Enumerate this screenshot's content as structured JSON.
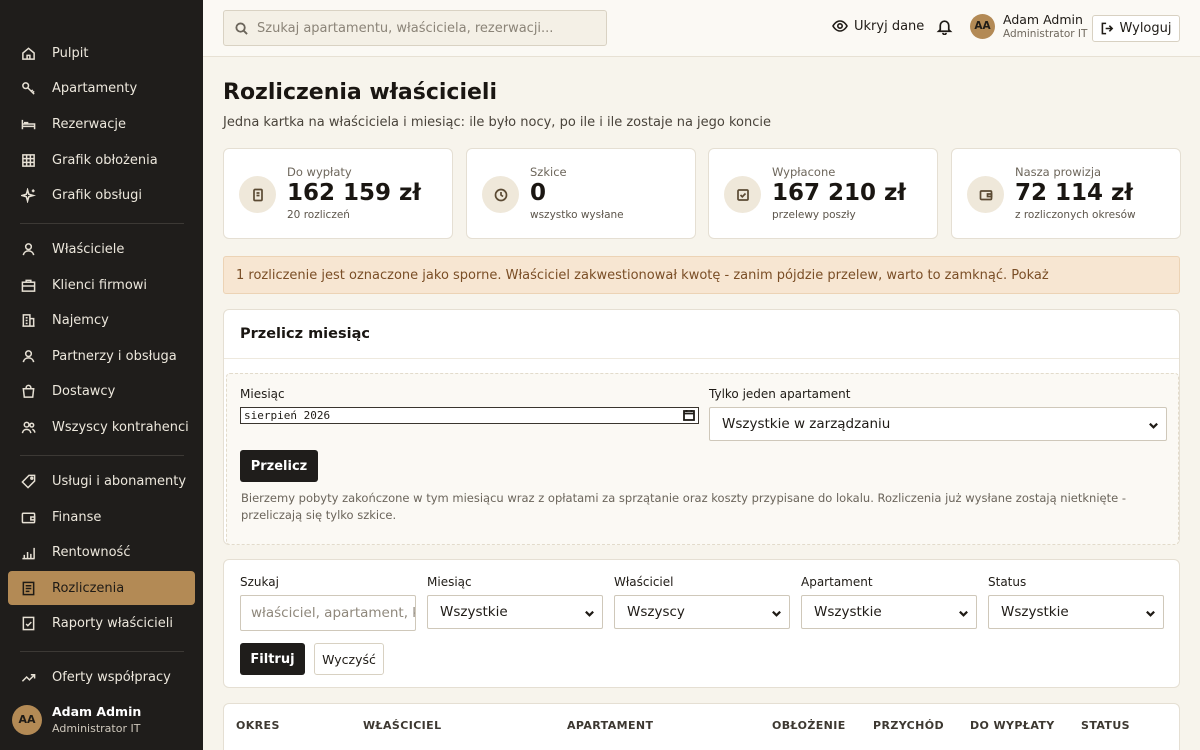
{
  "sidebar": {
    "items": [
      {
        "label": "Pulpit",
        "icon": "home-icon"
      },
      {
        "label": "Apartamenty",
        "icon": "key-icon"
      },
      {
        "label": "Rezerwacje",
        "icon": "bed-icon"
      },
      {
        "label": "Grafik obłożenia",
        "icon": "grid-icon"
      },
      {
        "label": "Grafik obsługi",
        "icon": "sparkle-icon"
      },
      {
        "label": "Właściciele",
        "icon": "user-icon"
      },
      {
        "label": "Klienci firmowi",
        "icon": "briefcase-icon"
      },
      {
        "label": "Najemcy",
        "icon": "building-icon"
      },
      {
        "label": "Partnerzy i obsługa",
        "icon": "user-icon"
      },
      {
        "label": "Dostawcy",
        "icon": "bag-icon"
      },
      {
        "label": "Wszyscy kontrahenci",
        "icon": "users-icon"
      },
      {
        "label": "Usługi i abonamenty",
        "icon": "tag-icon"
      },
      {
        "label": "Finanse",
        "icon": "wallet-icon"
      },
      {
        "label": "Rentowność",
        "icon": "bar-chart-icon"
      },
      {
        "label": "Rozliczenia",
        "icon": "receipt-icon"
      },
      {
        "label": "Raporty właścicieli",
        "icon": "check-doc-icon"
      },
      {
        "label": "Oferty współpracy",
        "icon": "trend-icon"
      }
    ],
    "active": "Rozliczenia",
    "user": {
      "initials": "AA",
      "name": "Adam Admin",
      "role": "Administrator IT"
    }
  },
  "topbar": {
    "search_placeholder": "Szukaj apartamentu, właściciela, rezerwacji...",
    "hide_data_label": "Ukryj dane",
    "user": {
      "initials": "AA",
      "name": "Adam Admin",
      "role": "Administrator IT"
    },
    "logout_label": "Wyloguj"
  },
  "page": {
    "title": "Rozliczenia właścicieli",
    "subtitle": "Jedna kartka na właściciela i miesiąc: ile było nocy, po ile i ile zostaje na jego koncie"
  },
  "stats": [
    {
      "label": "Do wypłaty",
      "value": "162 159 zł",
      "sub": "20 rozliczeń",
      "icon": "document-icon"
    },
    {
      "label": "Szkice",
      "value": "0",
      "sub": "wszystko wysłane",
      "icon": "clock-icon"
    },
    {
      "label": "Wypłacone",
      "value": "167 210 zł",
      "sub": "przelewy poszły",
      "icon": "checkbox-icon"
    },
    {
      "label": "Nasza prowizja",
      "value": "72 114 zł",
      "sub": "z rozliczonych okresów",
      "icon": "wallet-icon"
    }
  ],
  "alert": {
    "text": "1 rozliczenie jest oznaczone jako sporne. Właściciel zakwestionował kwotę - zanim pójdzie przelew, warto to zamknąć. Pokaż"
  },
  "recalc": {
    "title": "Przelicz miesiąc",
    "month_label": "Miesiąc",
    "month_value": "sierpień 2026",
    "apartment_label": "Tylko jeden apartament",
    "apartment_value": "Wszystkie w zarządzaniu",
    "button_label": "Przelicz",
    "help_text": "Bierzemy pobyty zakończone w tym miesiącu wraz z opłatami za sprzątanie oraz koszty przypisane do lokalu. Rozliczenia już wysłane zostają nietknięte - przeliczają się tylko szkice."
  },
  "filters": {
    "search_label": "Szukaj",
    "search_placeholder": "właściciel, apartament, kwota",
    "month_label": "Miesiąc",
    "month_value": "Wszystkie",
    "owner_label": "Właściciel",
    "owner_value": "Wszyscy",
    "apartment_label": "Apartament",
    "apartment_value": "Wszystkie",
    "status_label": "Status",
    "status_value": "Wszystkie",
    "filter_button": "Filtruj",
    "clear_button": "Wyczyść"
  },
  "table": {
    "headers": [
      "OKRES",
      "WŁAŚCICIEL",
      "APARTAMENT",
      "OBŁOŻENIE",
      "PRZYCHÓD",
      "DO WYPŁATY",
      "STATUS"
    ]
  },
  "colors": {
    "accent": "#b38a55",
    "sidebar_bg": "#1f1d1b",
    "page_bg": "#f7f4ec",
    "alert_bg": "#f7e6d2"
  }
}
